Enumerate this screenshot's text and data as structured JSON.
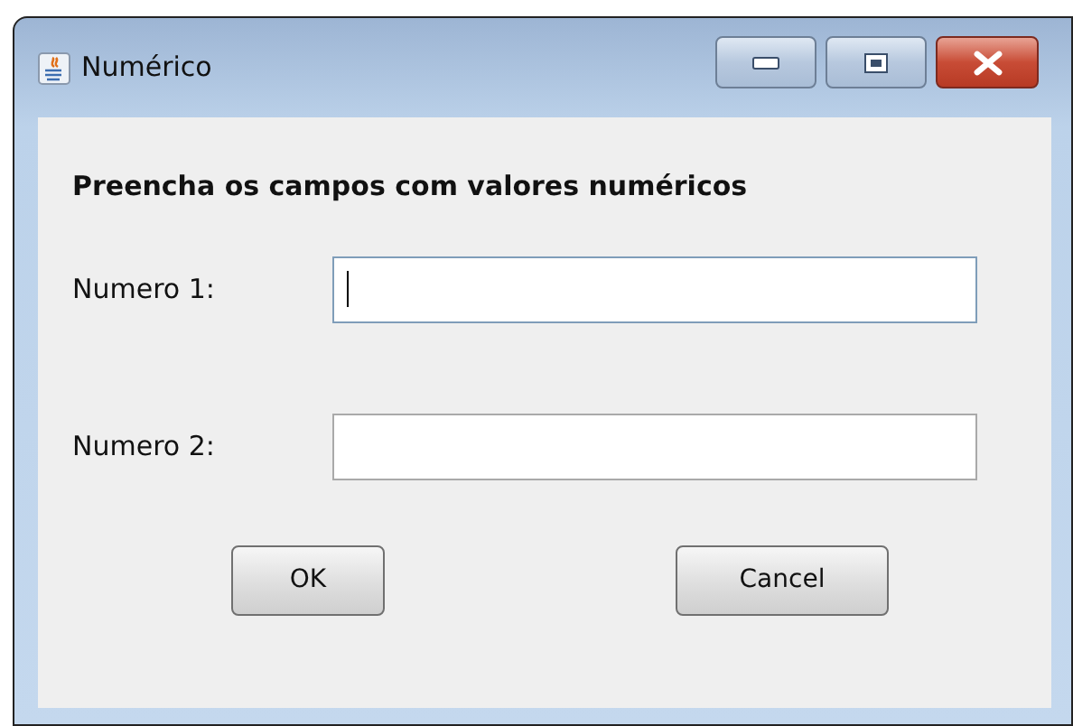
{
  "window": {
    "title": "Numérico"
  },
  "heading": "Preencha os campos com valores numéricos",
  "fields": [
    {
      "label": "Numero 1:",
      "focused": true
    },
    {
      "label": "Numero 2:",
      "focused": false
    }
  ],
  "buttons": [
    "OK",
    "Cancel"
  ]
}
